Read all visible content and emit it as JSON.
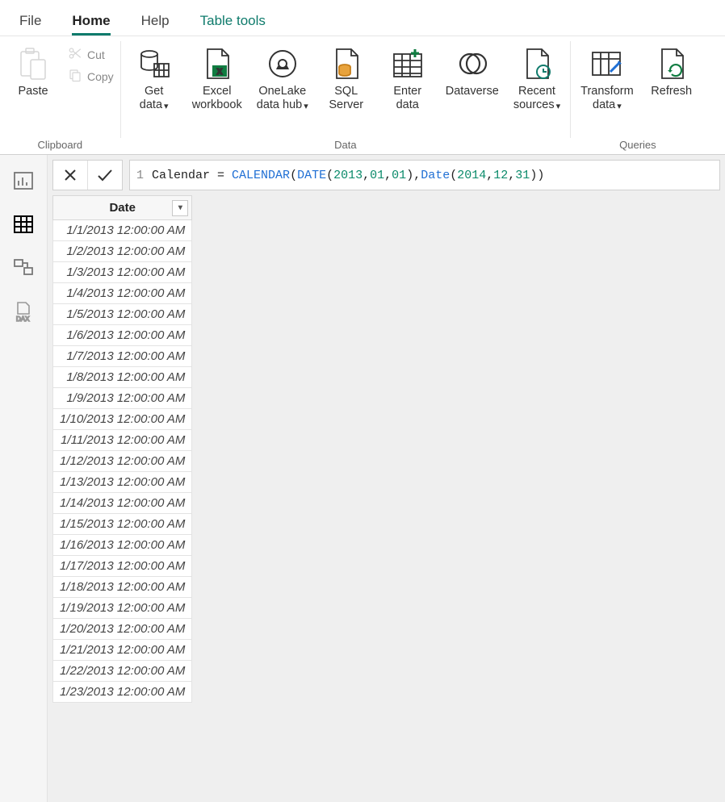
{
  "tabs": {
    "file": "File",
    "home": "Home",
    "help": "Help",
    "tabletools": "Table tools"
  },
  "ribbon": {
    "clipboard": {
      "paste": "Paste",
      "cut": "Cut",
      "copy": "Copy",
      "group": "Clipboard"
    },
    "data": {
      "getdata": "Get\ndata",
      "excel": "Excel\nworkbook",
      "onelake": "OneLake\ndata hub",
      "sql": "SQL\nServer",
      "enter": "Enter\ndata",
      "dataverse": "Dataverse",
      "recent": "Recent\nsources",
      "group": "Data"
    },
    "queries": {
      "transform": "Transform\ndata",
      "refresh": "Refresh",
      "group": "Queries"
    }
  },
  "formula": {
    "line": "1",
    "tokens": [
      "Calendar",
      " = ",
      "CALENDAR",
      "(",
      "DATE",
      "(",
      "2013",
      ",",
      "01",
      ",",
      "01",
      ")",
      ",",
      "Date",
      "(",
      "2014",
      ",",
      "12",
      ",",
      "31",
      ")",
      ")"
    ]
  },
  "table": {
    "header": "Date",
    "rows": [
      "1/1/2013 12:00:00 AM",
      "1/2/2013 12:00:00 AM",
      "1/3/2013 12:00:00 AM",
      "1/4/2013 12:00:00 AM",
      "1/5/2013 12:00:00 AM",
      "1/6/2013 12:00:00 AM",
      "1/7/2013 12:00:00 AM",
      "1/8/2013 12:00:00 AM",
      "1/9/2013 12:00:00 AM",
      "1/10/2013 12:00:00 AM",
      "1/11/2013 12:00:00 AM",
      "1/12/2013 12:00:00 AM",
      "1/13/2013 12:00:00 AM",
      "1/14/2013 12:00:00 AM",
      "1/15/2013 12:00:00 AM",
      "1/16/2013 12:00:00 AM",
      "1/17/2013 12:00:00 AM",
      "1/18/2013 12:00:00 AM",
      "1/19/2013 12:00:00 AM",
      "1/20/2013 12:00:00 AM",
      "1/21/2013 12:00:00 AM",
      "1/22/2013 12:00:00 AM",
      "1/23/2013 12:00:00 AM"
    ]
  }
}
